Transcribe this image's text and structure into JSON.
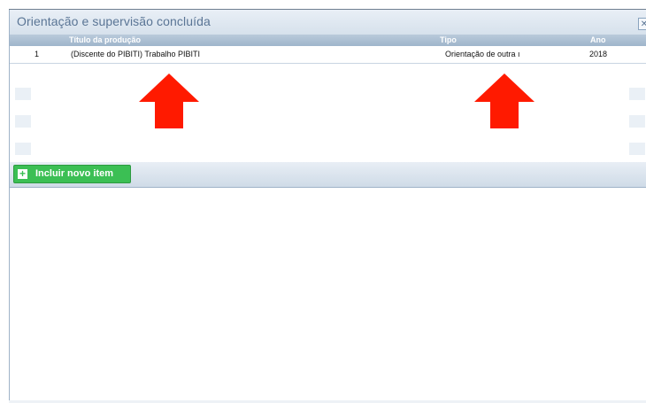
{
  "panel": {
    "title": "Orientação e supervisão concluída",
    "close_icon": "close-icon"
  },
  "table": {
    "columns": [
      "Título da produção",
      "Tipo",
      "Ano"
    ],
    "rows": [
      {
        "index": "1",
        "titulo": "(Discente do PIBITI) Trabalho PIBITI",
        "tipo": "Orientação de outra ı",
        "ano": "2018"
      }
    ]
  },
  "toolbar": {
    "add_button_label": "Incluir novo item",
    "add_icon": "plus-icon"
  },
  "annotations": {
    "arrow_color": "#ff1a00"
  }
}
